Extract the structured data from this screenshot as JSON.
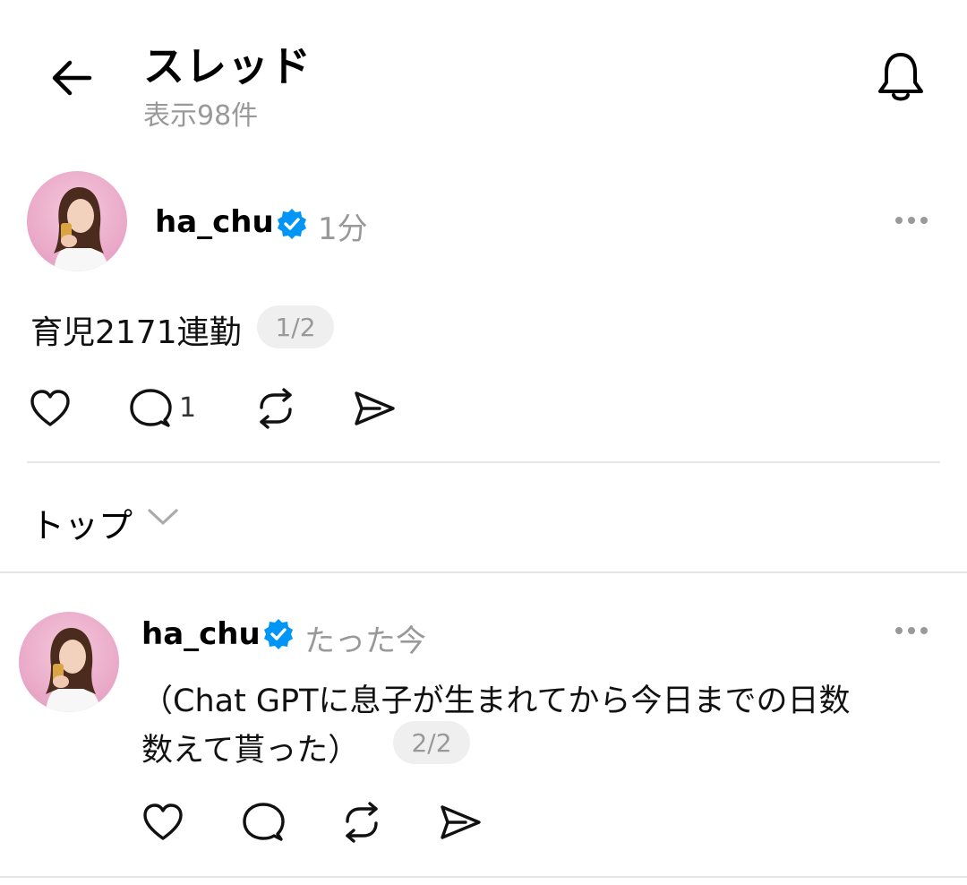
{
  "header": {
    "title": "スレッド",
    "subtitle": "表示98件",
    "back_icon": "arrow-left-icon",
    "notify_icon": "bell-icon"
  },
  "main_post": {
    "username": "ha_chu",
    "verified": true,
    "timestamp": "1分",
    "text": "育児2171連勤",
    "pager": "1/2",
    "actions": {
      "like_icon": "heart-icon",
      "comment_icon": "comment-icon",
      "comment_count": "1",
      "repost_icon": "repost-icon",
      "share_icon": "send-icon"
    }
  },
  "sort": {
    "label": "トップ",
    "icon": "chevron-down-icon"
  },
  "reply": {
    "username": "ha_chu",
    "verified": true,
    "timestamp": "たった今",
    "text_line1": "（Chat GPTに息子が生まれてから今日までの日数",
    "text_line2": "数えて貰った）",
    "pager": "2/2",
    "actions": {
      "like_icon": "heart-icon",
      "comment_icon": "comment-icon",
      "repost_icon": "repost-icon",
      "share_icon": "send-icon"
    }
  },
  "colors": {
    "verified_blue": "#0095f6",
    "secondary_text": "#999999",
    "divider": "#e5e5e5"
  }
}
